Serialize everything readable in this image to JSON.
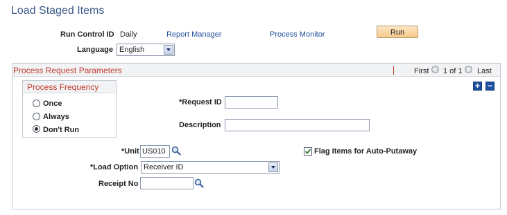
{
  "page": {
    "title": "Load Staged Items"
  },
  "header": {
    "run_control_label": "Run Control ID",
    "run_control_value": "Daily",
    "report_manager_link": "Report Manager",
    "process_monitor_link": "Process Monitor",
    "run_button": "Run",
    "language_label": "Language",
    "language_value": "English"
  },
  "params": {
    "title": "Process Request Parameters",
    "nav_first": "First",
    "nav_range": "1 of 1",
    "nav_last": "Last",
    "add_icon_glyph": "+",
    "remove_icon_glyph": "−"
  },
  "frequency": {
    "title": "Process Frequency",
    "options": [
      {
        "label": "Once",
        "checked": false
      },
      {
        "label": "Always",
        "checked": false
      },
      {
        "label": "Don't Run",
        "checked": true
      }
    ]
  },
  "fields": {
    "request_id_label": "*Request ID",
    "request_id_value": "",
    "description_label": "Description",
    "description_value": "",
    "unit_label": "*Unit",
    "unit_value": "US010",
    "flag_label": "Flag Items for Auto-Putaway",
    "flag_checked": true,
    "load_option_label": "*Load Option",
    "load_option_value": "Receiver ID",
    "receipt_label": "Receipt No",
    "receipt_value": ""
  },
  "colors": {
    "title": "#3c5a8a",
    "link": "#1f4e9c",
    "section_title": "#c0392b",
    "run_button": "#f7c98b"
  }
}
